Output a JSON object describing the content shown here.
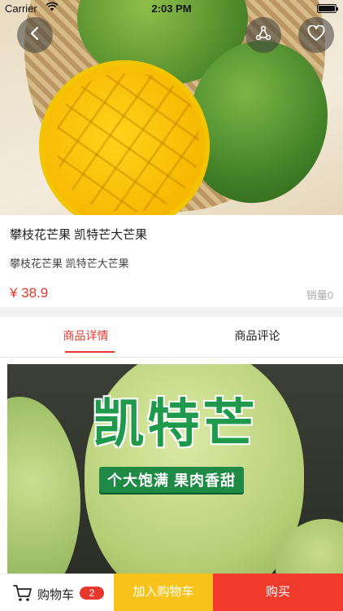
{
  "status_bar": {
    "carrier": "Carrier",
    "time": "2:03 PM"
  },
  "product": {
    "title": "攀枝花芒果 凯特芒大芒果",
    "subtitle": "攀枝花芒果 凯特芒大芒果",
    "price": "¥ 38.9",
    "sales": "销量0"
  },
  "tabs": [
    {
      "label": "商品详情",
      "active": true
    },
    {
      "label": "商品评论",
      "active": false
    }
  ],
  "detail_banner": {
    "headline": "凯特芒",
    "slogan": "个大饱满 果肉香甜"
  },
  "bottom_bar": {
    "cart_label": "购物车",
    "cart_count": "2",
    "add_to_cart": "加入购物车",
    "buy_now": "购买"
  },
  "colors": {
    "accent": "#e8372c",
    "add_to_cart_bg": "#f7c31a",
    "buy_bg": "#ef3a2c"
  },
  "icons": {
    "back": "chevron-left-icon",
    "share": "share-icon",
    "favorite": "heart-icon",
    "cart": "cart-icon",
    "wifi": "wifi-icon",
    "battery": "battery-icon"
  }
}
